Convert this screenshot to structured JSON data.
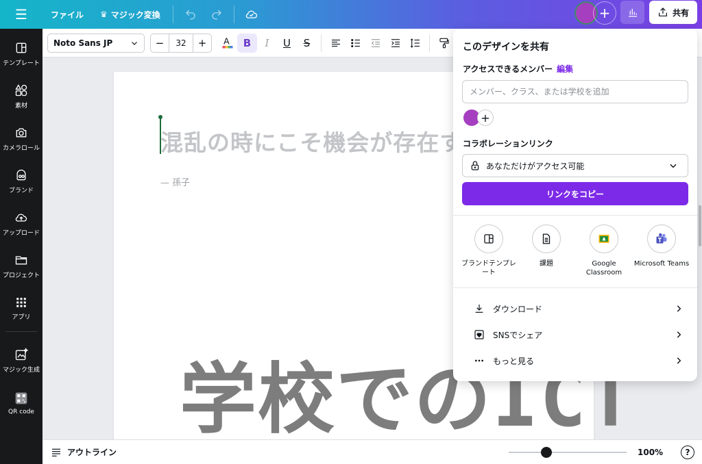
{
  "topbar": {
    "file_label": "ファイル",
    "magic_label": "マジック変換",
    "share_label": "共有"
  },
  "sidebar": {
    "items": [
      {
        "label": "テンプレート",
        "icon": "template-icon"
      },
      {
        "label": "素材",
        "icon": "elements-icon"
      },
      {
        "label": "カメラロール",
        "icon": "camera-icon"
      },
      {
        "label": "ブランド",
        "icon": "brand-icon"
      },
      {
        "label": "アップロード",
        "icon": "upload-icon"
      },
      {
        "label": "プロジェクト",
        "icon": "folder-icon"
      },
      {
        "label": "アプリ",
        "icon": "apps-icon"
      },
      {
        "label": "マジック生成",
        "icon": "magic-generate-icon"
      },
      {
        "label": "QR code",
        "icon": "qr-code-icon"
      }
    ]
  },
  "toolbar": {
    "font_name": "Noto Sans JP",
    "font_size": "32",
    "minus": "−",
    "plus": "+"
  },
  "canvas": {
    "quote": "混乱の時にこそ機会が存在する",
    "author": "— 孫子"
  },
  "watermark": "学校でのICT",
  "bottombar": {
    "outline_label": "アウトライン",
    "zoom": "100%",
    "help": "?"
  },
  "share_panel": {
    "title": "このデザインを共有",
    "access_label": "アクセスできるメンバー",
    "edit_label": "編集",
    "input_placeholder": "メンバー、クラス、または学校を追加",
    "collab_label": "コラボレーションリンク",
    "access_value": "あなただけがアクセス可能",
    "copy_button": "リンクをコピー",
    "options": [
      {
        "label": "ブランドテンプレート",
        "icon": "brand-template-icon"
      },
      {
        "label": "課題",
        "icon": "assignment-icon"
      },
      {
        "label": "Google Classroom",
        "icon": "google-classroom-icon"
      },
      {
        "label": "Microsoft Teams",
        "icon": "microsoft-teams-icon"
      }
    ],
    "rows": [
      {
        "label": "ダウンロード",
        "icon": "download-icon"
      },
      {
        "label": "SNSでシェア",
        "icon": "social-share-icon"
      },
      {
        "label": "もっと見る",
        "icon": "more-icon"
      }
    ]
  },
  "colors": {
    "accent": "#7d2ae8",
    "avatar": "#a63fbf",
    "sidebar_bg": "#18191b"
  }
}
